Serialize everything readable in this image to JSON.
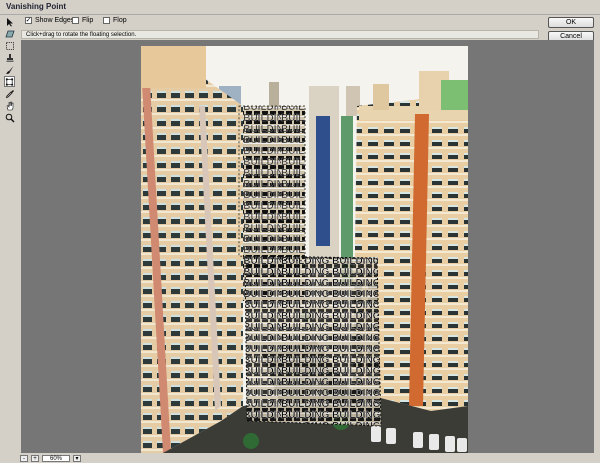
{
  "window": {
    "title": "Vanishing Point"
  },
  "options": {
    "show_edges": {
      "label": "Show Edges",
      "checked": true
    },
    "flip": {
      "label": "Flip",
      "checked": false
    },
    "flop": {
      "label": "Flop",
      "checked": false
    }
  },
  "hint": "Click+drag to rotate the floating selection.",
  "buttons": {
    "ok": "OK",
    "cancel": "Cancel"
  },
  "tools": [
    "arrow-icon",
    "create-plane-icon",
    "marquee-icon",
    "stamp-icon",
    "brush-icon",
    "transform-icon",
    "eyedropper-icon",
    "hand-icon",
    "zoom-icon"
  ],
  "status": {
    "zoom_value": "60%",
    "zoom_out": "-",
    "zoom_in": "+"
  },
  "overlay_text": {
    "line": "BUILDING BUILDING BUILDIN"
  },
  "colors": {
    "facade_light": "#e4c59a",
    "stripe": "#d4703a",
    "sky": "#f4f2ec"
  }
}
